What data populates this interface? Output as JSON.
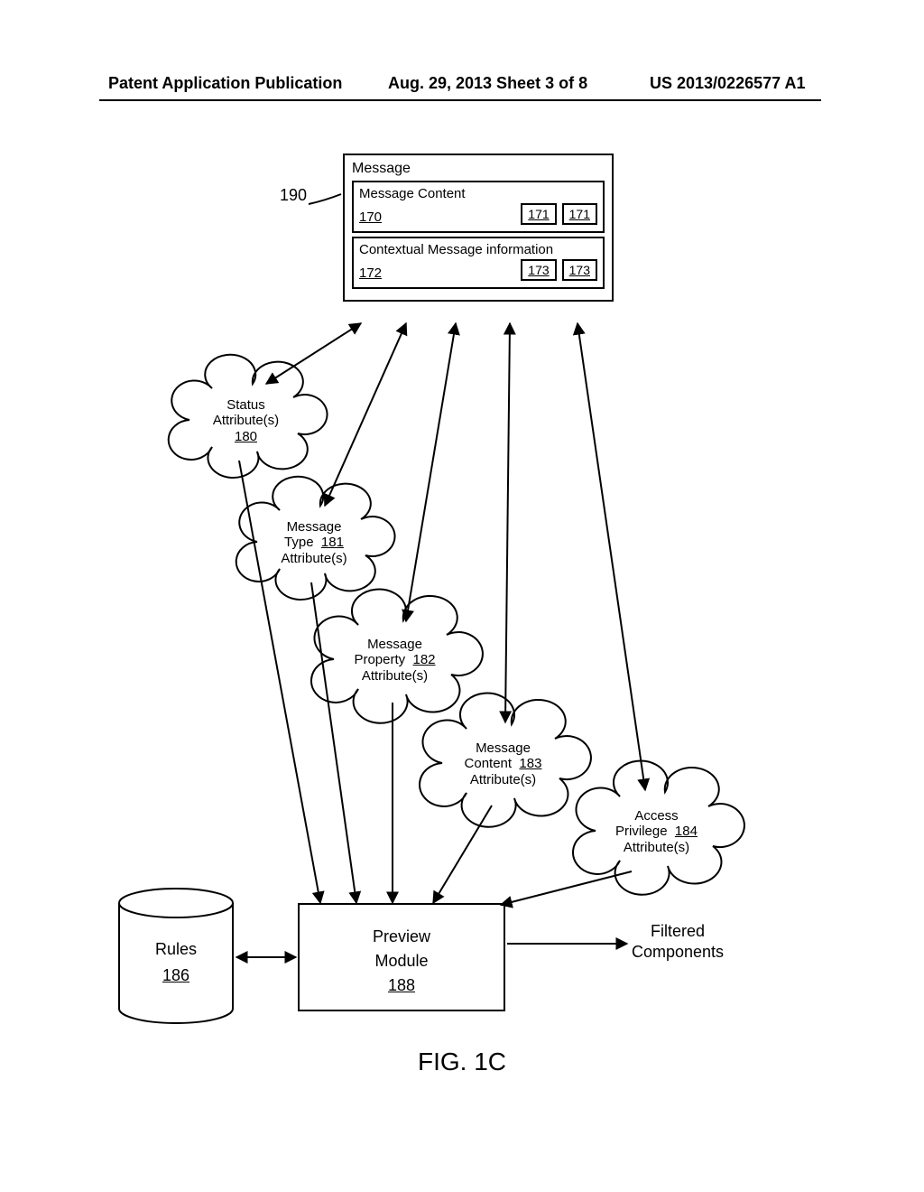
{
  "header": {
    "left": "Patent Application Publication",
    "date": "Aug. 29, 2013  Sheet 3 of 8",
    "pubno": "US 2013/0226577 A1"
  },
  "ref190": "190",
  "message_box": {
    "title": "Message",
    "content": {
      "title": "Message Content",
      "ref": "170",
      "mini": [
        "171",
        "171"
      ]
    },
    "context": {
      "title": "Contextual Message information",
      "ref": "172",
      "mini": [
        "173",
        "173"
      ]
    }
  },
  "clouds": {
    "status": {
      "l1": "Status",
      "l2": "Attribute(s)",
      "ref": "180"
    },
    "type": {
      "l1": "Message",
      "l2": "Type",
      "ref": "181",
      "l3": "Attribute(s)"
    },
    "prop": {
      "l1": "Message",
      "l2": "Property",
      "ref": "182",
      "l3": "Attribute(s)"
    },
    "content": {
      "l1": "Message",
      "l2": "Content",
      "ref": "183",
      "l3": "Attribute(s)"
    },
    "access": {
      "l1": "Access",
      "l2": "Privilege",
      "ref": "184",
      "l3": "Attribute(s)"
    }
  },
  "rules": {
    "label": "Rules",
    "ref": "186"
  },
  "preview": {
    "l1": "Preview",
    "l2": "Module",
    "ref": "188"
  },
  "filtered": {
    "l1": "Filtered",
    "l2": "Components"
  },
  "figure": "FIG. 1C"
}
